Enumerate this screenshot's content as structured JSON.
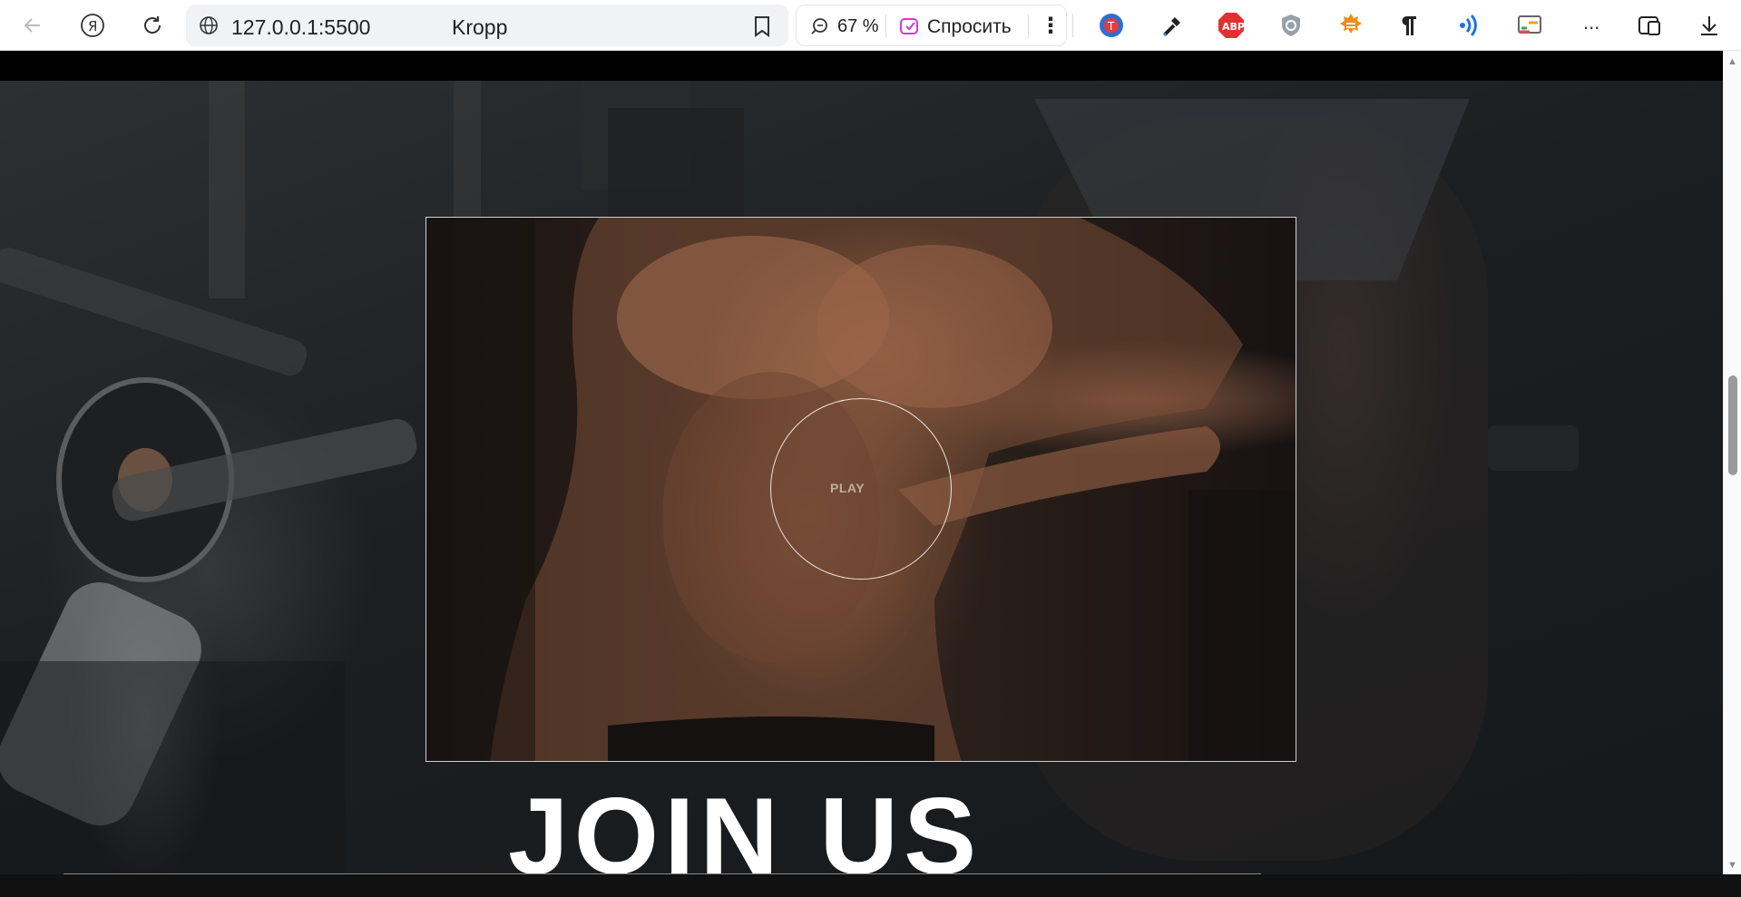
{
  "browser": {
    "url": "127.0.0.1:5500",
    "page_title": "Kropp",
    "zoom": "67 %",
    "ask_label": "Спросить",
    "more_extensions": "..."
  },
  "extensions": [
    "translate-icon",
    "eyedropper-icon",
    "adblock-icon",
    "shield-icon",
    "sun-icon",
    "paragraph-icon",
    "wifi-icon",
    "cast-icon"
  ],
  "page": {
    "video_play_label": "PLAY",
    "join_heading": "JOIN US",
    "colors": {
      "topbar": "#000000",
      "heading": "#ffffff"
    }
  }
}
